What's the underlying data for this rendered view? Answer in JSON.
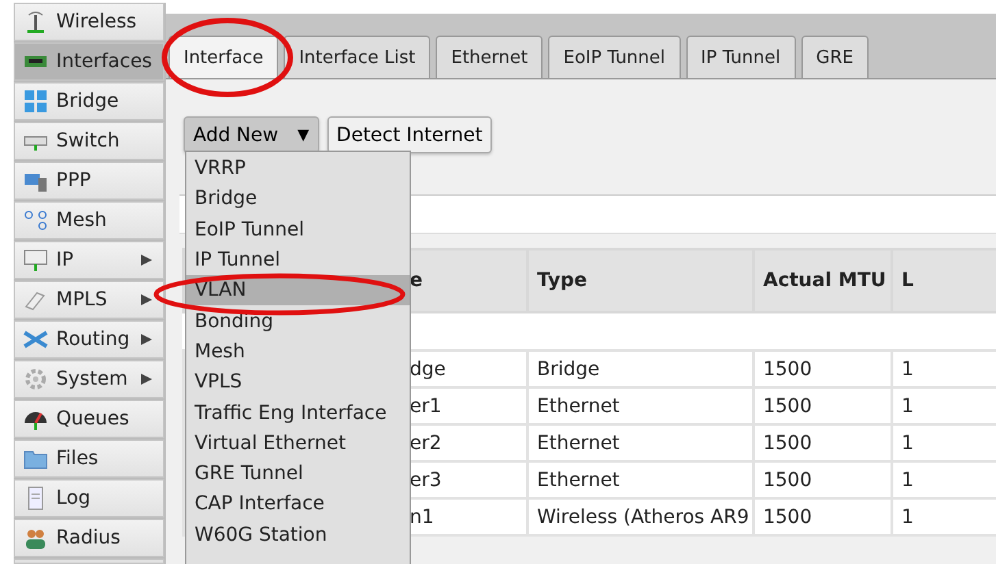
{
  "sidebar": {
    "items": [
      {
        "label": "Wireless",
        "selected": false,
        "submenu": false
      },
      {
        "label": "Interfaces",
        "selected": true,
        "submenu": false
      },
      {
        "label": "Bridge",
        "selected": false,
        "submenu": false
      },
      {
        "label": "Switch",
        "selected": false,
        "submenu": false
      },
      {
        "label": "PPP",
        "selected": false,
        "submenu": false
      },
      {
        "label": "Mesh",
        "selected": false,
        "submenu": false
      },
      {
        "label": "IP",
        "selected": false,
        "submenu": true
      },
      {
        "label": "MPLS",
        "selected": false,
        "submenu": true
      },
      {
        "label": "Routing",
        "selected": false,
        "submenu": true
      },
      {
        "label": "System",
        "selected": false,
        "submenu": true
      },
      {
        "label": "Queues",
        "selected": false,
        "submenu": false
      },
      {
        "label": "Files",
        "selected": false,
        "submenu": false
      },
      {
        "label": "Log",
        "selected": false,
        "submenu": false
      },
      {
        "label": "Radius",
        "selected": false,
        "submenu": false
      }
    ]
  },
  "tabs": [
    {
      "label": "Interface",
      "selected": true
    },
    {
      "label": "Interface List",
      "selected": false
    },
    {
      "label": "Ethernet",
      "selected": false
    },
    {
      "label": "EoIP Tunnel",
      "selected": false
    },
    {
      "label": "IP Tunnel",
      "selected": false
    },
    {
      "label": "GRE",
      "selected": false
    }
  ],
  "toolbar": {
    "add_new": {
      "label": "Add New",
      "caret": "▼"
    },
    "detect": "Detect Internet"
  },
  "add_menu": {
    "items": [
      {
        "label": "VRRP",
        "selected": false
      },
      {
        "label": "Bridge",
        "selected": false
      },
      {
        "label": "EoIP Tunnel",
        "selected": false
      },
      {
        "label": "IP Tunnel",
        "selected": false
      },
      {
        "label": "VLAN",
        "selected": true
      },
      {
        "label": "Bonding",
        "selected": false
      },
      {
        "label": "Mesh",
        "selected": false
      },
      {
        "label": "VPLS",
        "selected": false
      },
      {
        "label": "Traffic Eng Interface",
        "selected": false
      },
      {
        "label": "Virtual Ethernet",
        "selected": false
      },
      {
        "label": "GRE Tunnel",
        "selected": false
      },
      {
        "label": "CAP Interface",
        "selected": false
      },
      {
        "label": "W60G Station",
        "selected": false
      }
    ]
  },
  "table": {
    "columns": [
      "e",
      "Type",
      "Actual MTU",
      "L"
    ],
    "rows": [
      [
        "dge",
        "Bridge",
        "1500",
        "1"
      ],
      [
        "er1",
        "Ethernet",
        "1500",
        "1"
      ],
      [
        "er2",
        "Ethernet",
        "1500",
        "1"
      ],
      [
        "er3",
        "Ethernet",
        "1500",
        "1"
      ],
      [
        "n1",
        "Wireless (Atheros AR9",
        "1500",
        "1"
      ]
    ]
  }
}
